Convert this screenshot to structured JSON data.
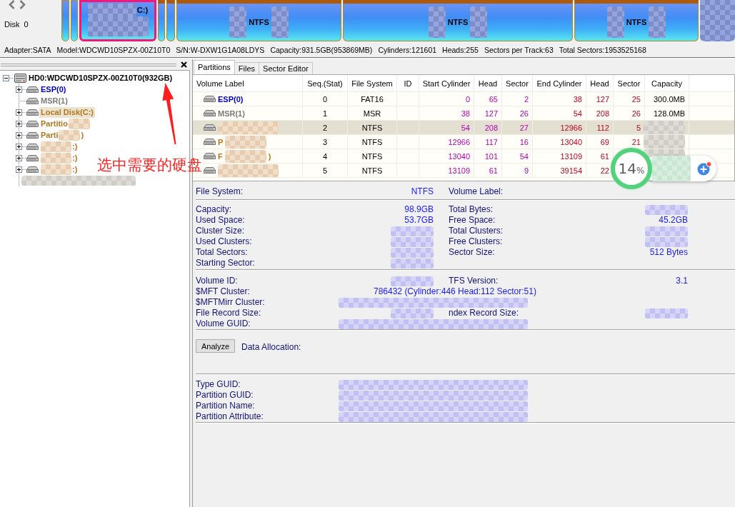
{
  "disk_bar": {
    "disk_label": "Disk 0",
    "segments": [
      {
        "kind": "primary",
        "selected": false
      },
      {
        "kind": "primary",
        "selected": false
      },
      {
        "kind": "primary",
        "label": "C:)",
        "redacted": true,
        "selected": true
      },
      {
        "kind": "logical",
        "selected": false
      },
      {
        "kind": "logical",
        "selected": false
      },
      {
        "kind": "logical",
        "file_system": "NTFS",
        "redacted": true,
        "selected": false
      },
      {
        "kind": "logical",
        "file_system": "NTFS",
        "redacted": true,
        "selected": false
      },
      {
        "kind": "logical",
        "file_system": "NTFS",
        "redacted": true,
        "selected": false
      },
      {
        "kind": "masked",
        "selected": false
      }
    ]
  },
  "disk_info": [
    "Adapter:SATA",
    "Model:WDCWD10SPZX-00Z10T0",
    "S/N:W-DXW1G1A08LDYS",
    "Capacity:931.5GB(953869MB)",
    "Cylinders:121601",
    "Heads:255",
    "Sectors per Track:63",
    "Total Sectors:1953525168"
  ],
  "tree": {
    "root": {
      "label": "HD0:WDCWD10SPZX-00Z10T0(932GB)",
      "expanded": true,
      "selected": false,
      "children": [
        {
          "kind": "node",
          "label": "ESP(0)",
          "color": "#0000cc",
          "expanded": false,
          "selected": false
        },
        {
          "kind": "leaf",
          "label": "MSR(1)",
          "color": "#7b7b7b",
          "selected": false
        },
        {
          "kind": "node",
          "label": "Local Disk(C:)",
          "color": "#b8741a",
          "expanded": false,
          "selected": true
        },
        {
          "kind": "node",
          "label": "Partitio",
          "color": "#b8741a",
          "redacted": true,
          "expanded": false,
          "selected": false
        },
        {
          "kind": "node",
          "label": "Parti",
          "label_tail": ")",
          "color": "#b8741a",
          "redacted": true,
          "expanded": false,
          "selected": false
        },
        {
          "kind": "node",
          "label_tail": ":)",
          "color": "#b8741a",
          "redacted": true,
          "expanded": false,
          "selected": false
        },
        {
          "kind": "node",
          "label_tail": ":)",
          "color": "#b8741a",
          "redacted": true,
          "expanded": false,
          "selected": false
        },
        {
          "kind": "node",
          "label_tail": ":)",
          "color": "#b8741a",
          "redacted": true,
          "expanded": false,
          "selected": false
        },
        {
          "kind": "masked",
          "selected": false
        }
      ]
    }
  },
  "annotation": {
    "text": "选中需要的硬盘"
  },
  "tabs": [
    {
      "label": "Partitions",
      "selected": true
    },
    {
      "label": "Files",
      "selected": false
    },
    {
      "label": "Sector Editor",
      "selected": false
    }
  ],
  "table": {
    "columns": [
      "Volume Label",
      "Seq.(Stat)",
      "File System",
      "ID",
      "Start Cylinder",
      "Head",
      "Sector",
      "End Cylinder",
      "Head",
      "Sector",
      "Capacity"
    ],
    "rows": [
      {
        "volume_label": "ESP(0)",
        "color": "#0000cc",
        "seq": "0",
        "file_system": "FAT16",
        "start_cylinder": "0",
        "start_head": "65",
        "start_sector": "2",
        "end_cylinder": "38",
        "end_head": "127",
        "end_sector": "25",
        "capacity": "300.0MB",
        "selected": false
      },
      {
        "volume_label": "MSR(1)",
        "color": "#7b7b7b",
        "seq": "1",
        "file_system": "MSR",
        "start_cylinder": "38",
        "start_head": "127",
        "start_sector": "26",
        "end_cylinder": "54",
        "end_head": "208",
        "end_sector": "26",
        "capacity": "128.0MB",
        "selected": false
      },
      {
        "label_redacted": true,
        "seq": "2",
        "file_system": "NTFS",
        "start_cylinder": "54",
        "start_head": "208",
        "start_sector": "27",
        "end_cylinder": "12966",
        "end_head": "112",
        "end_sector": "5",
        "capacity_redacted": true,
        "selected": true
      },
      {
        "volume_label": "P",
        "color": "#b8741a",
        "label_redacted": true,
        "seq": "3",
        "file_system": "NTFS",
        "start_cylinder": "12966",
        "start_head": "117",
        "start_sector": "16",
        "end_cylinder": "13040",
        "end_head": "69",
        "end_sector": "21",
        "capacity_redacted": true,
        "selected": false
      },
      {
        "volume_label": "F",
        "label_tail": ")",
        "color": "#b8741a",
        "label_redacted": true,
        "seq": "4",
        "file_system": "NTFS",
        "start_cylinder": "13040",
        "start_head": "101",
        "start_sector": "54",
        "end_cylinder": "13109",
        "end_head": "61",
        "capacity_redacted": true,
        "selected": false
      },
      {
        "label_redacted": true,
        "seq": "5",
        "file_system": "NTFS",
        "start_cylinder": "13109",
        "start_head": "61",
        "start_sector": "9",
        "end_cylinder": "39154",
        "end_head": "22",
        "selected": false
      }
    ]
  },
  "details": {
    "sections": [
      {
        "kind": "fields",
        "rows": [
          [
            {
              "kind": "half",
              "label": "File System:",
              "value": "NTFS"
            },
            {
              "kind": "half",
              "label": "Volume Label:"
            }
          ]
        ]
      },
      {
        "kind": "fields",
        "rows": [
          [
            {
              "kind": "half",
              "label": "Capacity:",
              "value": "98.9GB"
            },
            {
              "kind": "half",
              "label": "Total Bytes:",
              "redacted": true
            }
          ],
          [
            {
              "kind": "half",
              "label": "Used Space:",
              "value": "53.7GB"
            },
            {
              "kind": "half",
              "label": "Free Space:",
              "value": "45.2GB"
            }
          ],
          [
            {
              "kind": "half",
              "label": "Cluster Size:",
              "redacted": true
            },
            {
              "kind": "half",
              "label": "Total Clusters:",
              "redacted": true
            }
          ],
          [
            {
              "kind": "half",
              "label": "Used Clusters:",
              "redacted": true
            },
            {
              "kind": "half",
              "label": "Free Clusters:",
              "redacted": true
            }
          ],
          [
            {
              "kind": "half",
              "label": "Total Sectors:",
              "redacted": true
            },
            {
              "kind": "half",
              "label": "Sector Size:",
              "value": "512 Bytes"
            }
          ],
          [
            {
              "kind": "half",
              "label": "Starting Sector:",
              "redacted": true
            }
          ]
        ]
      },
      {
        "kind": "fields",
        "rows": [
          [
            {
              "kind": "half",
              "label": "Volume ID:",
              "redacted": true
            },
            {
              "kind": "half",
              "label": "TFS Version:",
              "value": "3.1"
            }
          ],
          [
            {
              "kind": "wide",
              "label": "$MFT Cluster:",
              "value": "786432 (Cylinder:446 Head:112 Sector:51)"
            }
          ],
          [
            {
              "kind": "wide",
              "label": "$MFTMirr Cluster:",
              "redacted": true
            }
          ],
          [
            {
              "kind": "half",
              "label": "File Record Size:",
              "redacted": true
            },
            {
              "kind": "half",
              "label": "ndex Record Size:",
              "redacted": true
            }
          ],
          [
            {
              "kind": "wide",
              "label": "Volume GUID:",
              "redacted": true
            }
          ]
        ]
      },
      {
        "kind": "analyze",
        "button": "Analyze",
        "label": "Data Allocation:"
      },
      {
        "kind": "fields",
        "rows": [
          [
            {
              "kind": "wide",
              "label": "Type GUID:",
              "redacted": true
            }
          ],
          [
            {
              "kind": "wide",
              "label": "Partition GUID:",
              "redacted": true
            }
          ],
          [
            {
              "kind": "wide",
              "label": "Partition Name:",
              "redacted": true
            }
          ],
          [
            {
              "kind": "wide",
              "label": "Partition Attribute:",
              "redacted": true
            }
          ]
        ]
      }
    ]
  },
  "usage_widget": {
    "value": "14",
    "unit": "%",
    "redacted": true
  }
}
